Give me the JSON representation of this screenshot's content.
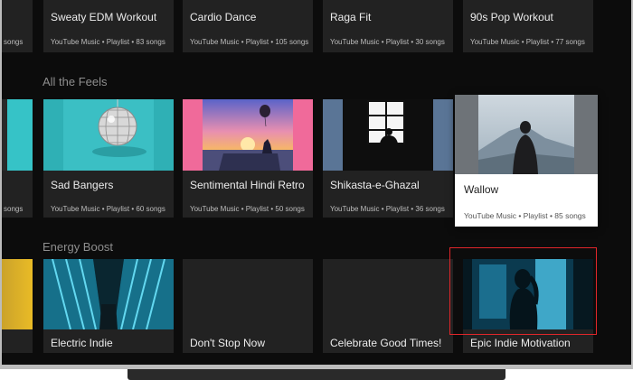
{
  "rows": {
    "top": {
      "cards": [
        {
          "title": "",
          "meta": "songs"
        },
        {
          "title": "Sweaty EDM Workout",
          "meta": "YouTube Music • Playlist • 83 songs"
        },
        {
          "title": "Cardio Dance",
          "meta": "YouTube Music • Playlist • 105 songs"
        },
        {
          "title": "Raga Fit",
          "meta": "YouTube Music • Playlist • 30 songs"
        },
        {
          "title": "90s Pop Workout",
          "meta": "YouTube Music • Playlist • 77 songs"
        }
      ]
    },
    "feels": {
      "label": "All the Feels",
      "cards": [
        {
          "title": "",
          "meta": "songs"
        },
        {
          "title": "Sad Bangers",
          "meta": "YouTube Music • Playlist • 60 songs"
        },
        {
          "title": "Sentimental Hindi Retro",
          "meta": "YouTube Music • Playlist • 50 songs"
        },
        {
          "title": "Shikasta-e-Ghazal",
          "meta": "YouTube Music • Playlist • 36 songs"
        },
        {
          "title": "Wallow",
          "meta": "YouTube Music • Playlist • 85 songs"
        }
      ]
    },
    "energy": {
      "label": "Energy Boost",
      "cards": [
        {
          "title": "Electric Indie"
        },
        {
          "title": "Don't Stop Now"
        },
        {
          "title": "Celebrate Good Times!"
        },
        {
          "title": "Epic Indie Motivation"
        }
      ]
    }
  },
  "colors": {
    "background": "#0c0c0c",
    "card": "#222222",
    "focus_ring": "#e0262a"
  }
}
